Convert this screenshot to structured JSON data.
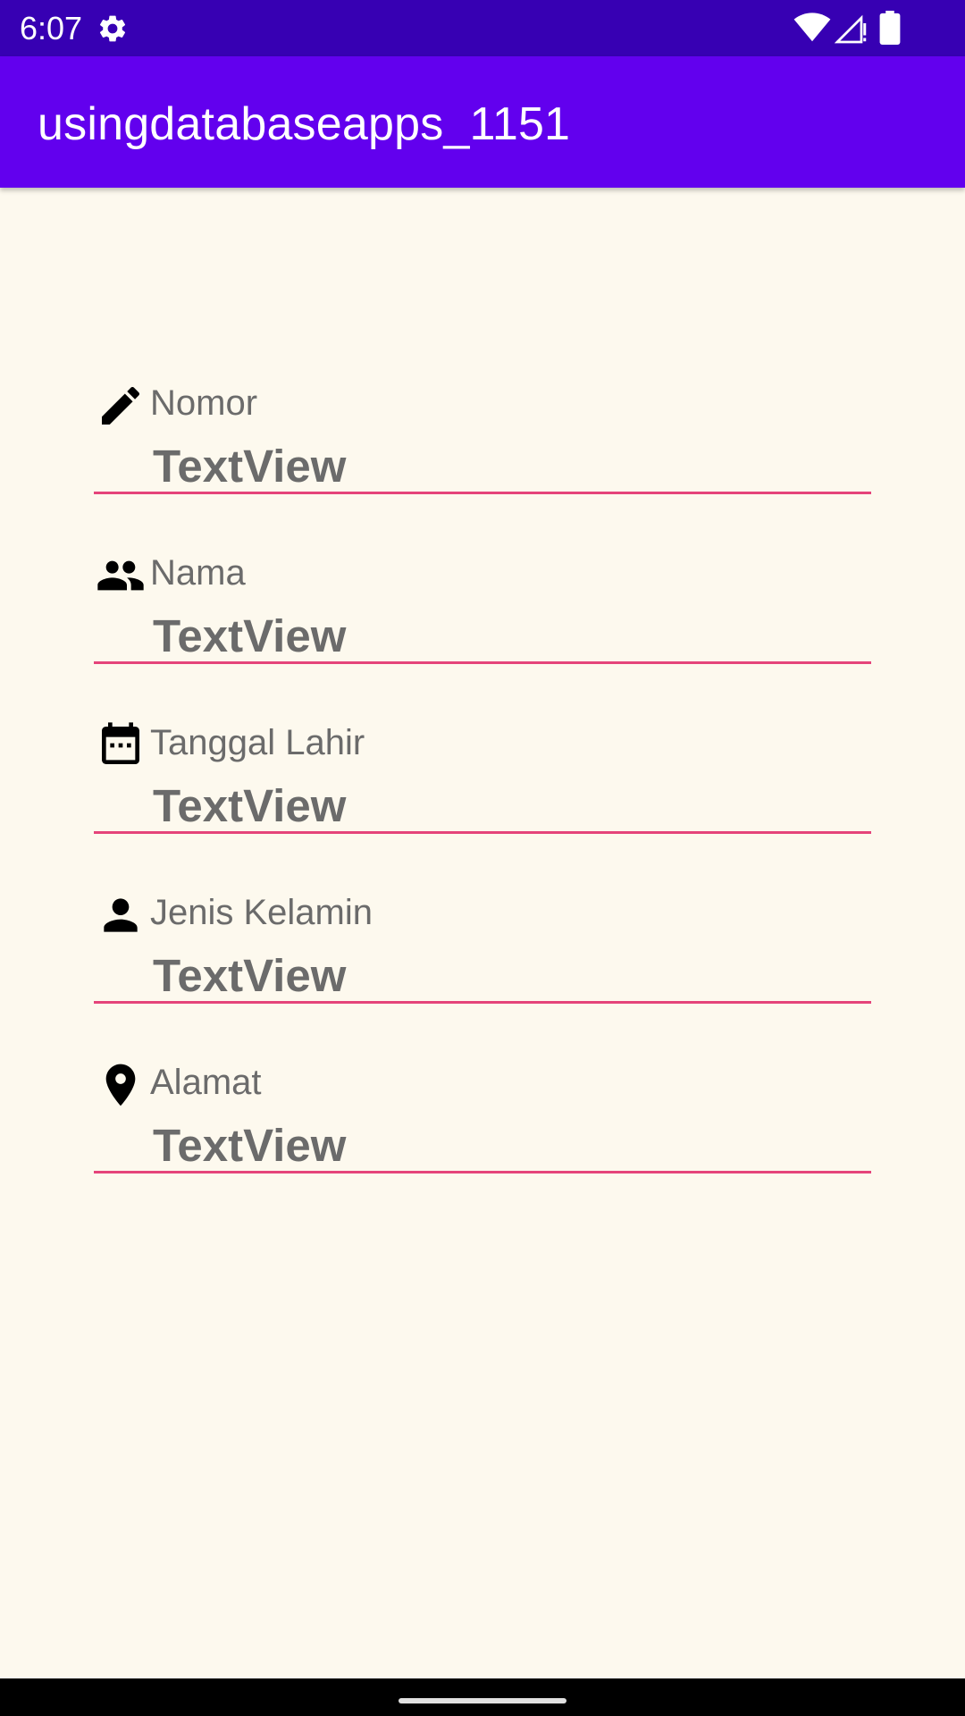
{
  "status_bar": {
    "time": "6:07",
    "icons": [
      "gear-icon",
      "wifi-icon",
      "signal-icon",
      "battery-icon"
    ]
  },
  "app_bar": {
    "title": "usingdatabaseapps_1151",
    "color": "#6200EE"
  },
  "fields": [
    {
      "icon": "pencil-icon",
      "label": "Nomor",
      "value": "TextView"
    },
    {
      "icon": "people-icon",
      "label": "Nama",
      "value": "TextView"
    },
    {
      "icon": "calendar-icon",
      "label": "Tanggal Lahir",
      "value": "TextView"
    },
    {
      "icon": "person-icon",
      "label": "Jenis Kelamin",
      "value": "TextView"
    },
    {
      "icon": "location-pin-icon",
      "label": "Alamat",
      "value": "TextView"
    }
  ],
  "colors": {
    "status_bar": "#3700B3",
    "background": "#FDF9EE",
    "underline": "#E5447A",
    "text_gray": "#6B6B6B"
  }
}
